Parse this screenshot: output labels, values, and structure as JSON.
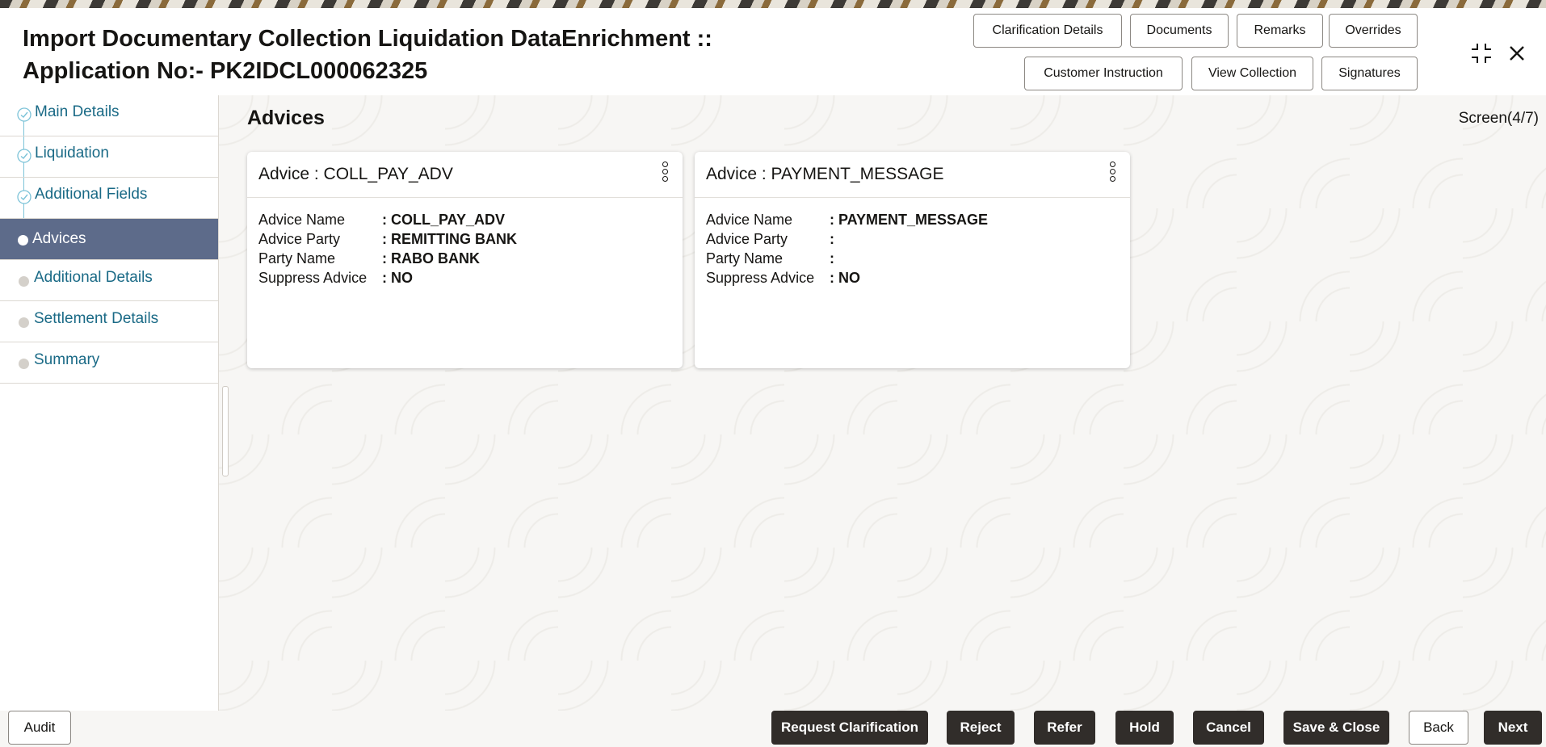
{
  "header": {
    "title_line1": "Import Documentary Collection Liquidation DataEnrichment ::",
    "title_line2": "Application No:- PK2IDCL000062325",
    "buttons": {
      "clarification_details": "Clarification Details",
      "documents": "Documents",
      "remarks": "Remarks",
      "overrides": "Overrides",
      "customer_instruction": "Customer Instruction",
      "view_collection": "View Collection",
      "signatures": "Signatures"
    },
    "icons": [
      "collapse-icon",
      "close-icon"
    ]
  },
  "sidebar": {
    "items": [
      {
        "label": "Main Details",
        "state": "completed"
      },
      {
        "label": "Liquidation",
        "state": "completed"
      },
      {
        "label": "Additional Fields",
        "state": "completed"
      },
      {
        "label": "Advices",
        "state": "active"
      },
      {
        "label": "Additional Details",
        "state": "pending"
      },
      {
        "label": "Settlement Details",
        "state": "pending"
      },
      {
        "label": "Summary",
        "state": "pending"
      }
    ]
  },
  "main": {
    "section_title": "Advices",
    "screen_count": "Screen(4/7)",
    "field_labels": {
      "advice_name": "Advice Name",
      "advice_party": "Advice Party",
      "party_name": "Party Name",
      "suppress_advice": "Suppress Advice"
    },
    "cards": [
      {
        "title": "Advice : COLL_PAY_ADV",
        "advice_name": "COLL_PAY_ADV",
        "advice_party": "REMITTING BANK",
        "party_name": "RABO BANK",
        "suppress_advice": "NO"
      },
      {
        "title": "Advice : PAYMENT_MESSAGE",
        "advice_name": "PAYMENT_MESSAGE",
        "advice_party": "",
        "party_name": "",
        "suppress_advice": "NO"
      }
    ]
  },
  "footer": {
    "audit": "Audit",
    "request_clarification": "Request Clarification",
    "reject": "Reject",
    "refer": "Refer",
    "hold": "Hold",
    "cancel": "Cancel",
    "save_close": "Save & Close",
    "back": "Back",
    "next": "Next"
  },
  "colors": {
    "active_nav_bg": "#5d6b8a",
    "nav_link": "#1a6a86",
    "primary_button": "#312d2a"
  }
}
